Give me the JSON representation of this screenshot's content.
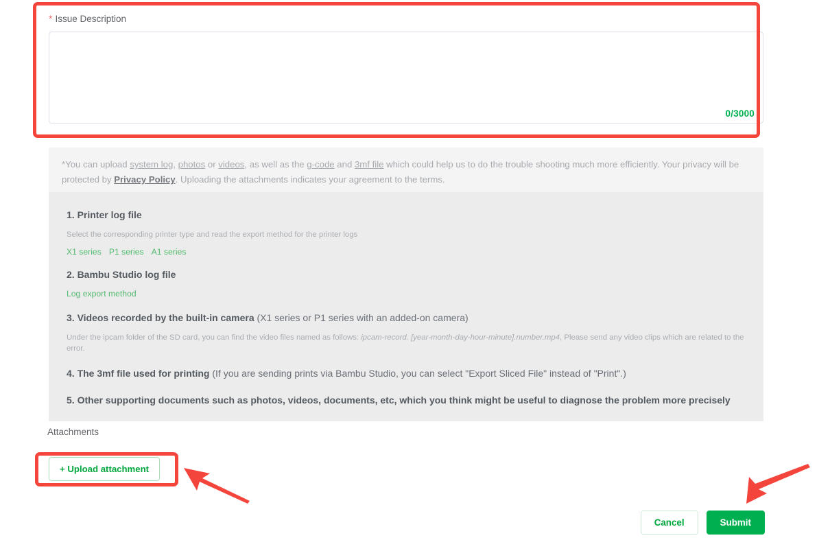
{
  "form": {
    "issue_description": {
      "label": "Issue Description",
      "required_marker": "*",
      "value": "",
      "placeholder": "",
      "char_counter": "0/3000"
    }
  },
  "hint": {
    "prefix": "*You can upload ",
    "link_system_log": "system log",
    "sep_1": ", ",
    "link_photos": "photos",
    "sep_2": " or ",
    "link_videos": "videos",
    "sep_3": ", as well as the ",
    "link_gcode": "g-code",
    "sep_4": " and ",
    "link_3mf": "3mf file",
    "suffix_1": " which could help us to do the trouble shooting much more efficiently. Your privacy will be protected by ",
    "link_privacy": "Privacy Policy",
    "suffix_2": ". Uploading the attachments indicates your agreement to the terms."
  },
  "instructions": {
    "item1": {
      "title": "1. Printer log file",
      "desc": "Select the corresponding printer type and read the export method for the printer logs",
      "links": [
        "X1 series",
        "P1 series",
        "A1 series"
      ]
    },
    "item2": {
      "title": "2. Bambu Studio log file",
      "links": [
        "Log export method"
      ]
    },
    "item3": {
      "title": "3. Videos recorded by the built-in camera",
      "title_normal": " (X1 series or P1 series with an added-on camera)",
      "desc_part1": "Under the ipcam folder of the SD card, you can find the video files named as follows: ",
      "desc_italic": "ipcam-record. [year-month-day-hour-minute].number.mp4",
      "desc_part2": ", Please send any video clips which are related to the error."
    },
    "item4": {
      "title": "4. The 3mf file used for printing",
      "title_normal": " (If you are sending prints via Bambu Studio, you can select \"Export Sliced File\" instead of \"Print\".)"
    },
    "item5": {
      "title": "5. Other supporting documents such as photos, videos, documents, etc, which you think might be useful to diagnose the problem more precisely"
    }
  },
  "attachments": {
    "label": "Attachments",
    "upload_button": "+ Upload attachment"
  },
  "footer": {
    "cancel_label": "Cancel",
    "submit_label": "Submit"
  },
  "annotations": {
    "highlight_color": "#f4453c",
    "boxes": [
      "issue-description-area",
      "upload-attachment-button"
    ],
    "arrows": [
      "arrow-to-upload-attachment",
      "arrow-to-submit"
    ]
  },
  "colors": {
    "accent_green": "#00b050",
    "link_green": "#52b96e",
    "required_red": "#f56c6c",
    "annotation_red": "#f4453c",
    "panel_top_bg": "#f4f4f5",
    "panel_body_bg": "#ececec"
  }
}
